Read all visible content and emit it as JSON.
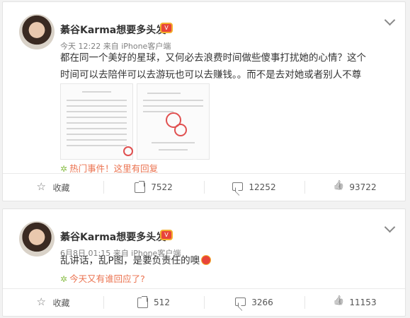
{
  "posts": [
    {
      "username": "綦谷Karma想要多头发",
      "meta": "今天 12:22 来自 iPhone客户端",
      "text": "都在同一个美好的星球，又何必去浪费时间做些傻事打扰她的心情？这个时间可以去陪伴可以去游玩也可以去赚钱。。而不是去对她或者别人不尊重。。",
      "topic": "热门事件！这里有回复",
      "actions": {
        "favorite": "收藏",
        "repost": "7522",
        "comment": "12252",
        "like": "93722"
      }
    },
    {
      "username": "綦谷Karma想要多头发",
      "meta": "6月8日 01:15 来自 iPhone客户端",
      "text": "乱讲话，乱P图，是要负责任的噢",
      "topic": "今天又有谁回应了?",
      "actions": {
        "favorite": "收藏",
        "repost": "512",
        "comment": "3266",
        "like": "11153"
      }
    }
  ],
  "colors": {
    "topic": "#eb7350",
    "background": "#f2f2f2"
  }
}
